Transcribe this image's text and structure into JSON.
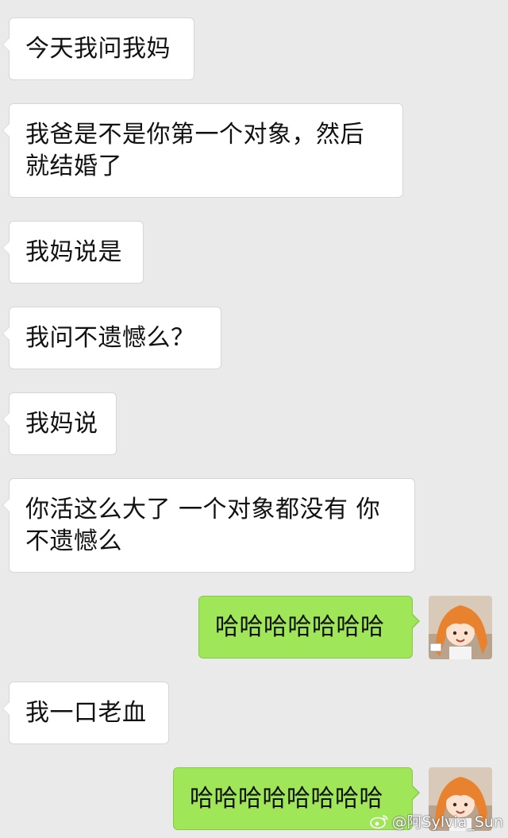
{
  "messages": [
    {
      "side": "in",
      "text": "今天我问我妈"
    },
    {
      "side": "in",
      "text": "我爸是不是你第一个对象，然后就结婚了"
    },
    {
      "side": "in",
      "text": "我妈说是"
    },
    {
      "side": "in",
      "text": "我问不遗憾么？"
    },
    {
      "side": "in",
      "text": "我妈说"
    },
    {
      "side": "in",
      "text": "你活这么大了 一个对象都没有 你不遗憾么"
    },
    {
      "side": "out",
      "text": "哈哈哈哈哈哈哈"
    },
    {
      "side": "in",
      "text": "我一口老血"
    },
    {
      "side": "out",
      "text": "哈哈哈哈哈哈哈哈"
    }
  ],
  "watermark": {
    "text": "@阿Sylvia_Sun"
  },
  "colors": {
    "background": "#eaeaea",
    "incoming_bubble": "#ffffff",
    "outgoing_bubble": "#9fe658",
    "avatar_hair": "#e8822f"
  }
}
